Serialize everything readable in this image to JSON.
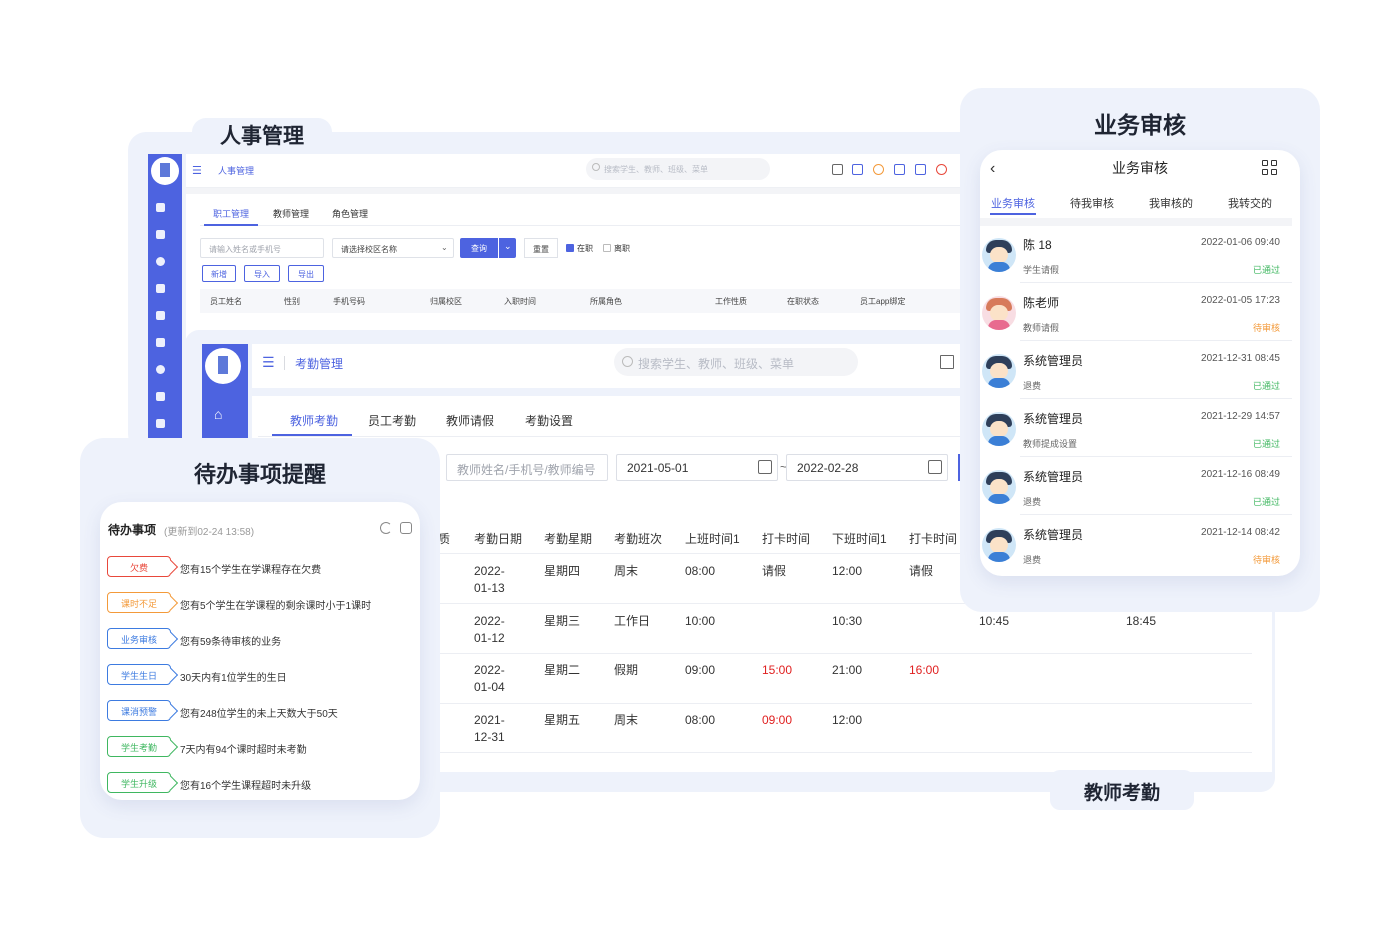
{
  "hr": {
    "section_title": "人事管理",
    "breadcrumb": "人事管理",
    "search_placeholder": "搜索学生、教师、班级、菜单",
    "tabs": [
      "职工管理",
      "教师管理",
      "角色管理"
    ],
    "name_input_placeholder": "请输入姓名或手机号",
    "campus_select": "请选择校区名称",
    "query_button": "查询",
    "reset_button": "重置",
    "checkbox_employed": "在职",
    "checkbox_left": "离职",
    "buttons": [
      "新增",
      "导入",
      "导出"
    ],
    "columns": [
      "员工姓名",
      "性别",
      "手机号码",
      "归属校区",
      "入职时间",
      "所属角色",
      "工作性质",
      "在职状态",
      "员工app绑定"
    ]
  },
  "attendance": {
    "breadcrumb": "考勤管理",
    "search_placeholder": "搜索学生、教师、班级、菜单",
    "tabs": [
      "教师考勤",
      "员工考勤",
      "教师请假",
      "考勤设置"
    ],
    "teacher_input_placeholder": "教师姓名/手机号/教师编号",
    "date_start": "2021-05-01",
    "date_separator": "~",
    "date_end": "2022-02-28",
    "columns": [
      "质",
      "考勤日期",
      "考勤星期",
      "考勤班次",
      "上班时间1",
      "打卡时间",
      "下班时间1",
      "打卡时间"
    ],
    "rows": [
      {
        "date_a": "2022-",
        "date_b": "01-13",
        "weekday": "星期四",
        "shift": "周末",
        "on1": "08:00",
        "punch1": "请假",
        "off1": "12:00",
        "punch2": "请假",
        "extra_a": "",
        "extra_b": ""
      },
      {
        "date_a": "2022-",
        "date_b": "01-12",
        "weekday": "星期三",
        "shift": "工作日",
        "on1": "10:00",
        "punch1": "",
        "off1": "10:30",
        "punch2": "",
        "extra_a": "10:45",
        "extra_b": "18:45"
      },
      {
        "date_a": "2022-",
        "date_b": "01-04",
        "weekday": "星期二",
        "shift": "假期",
        "on1": "09:00",
        "punch1": "15:00",
        "off1": "21:00",
        "punch2": "16:00",
        "extra_a": "",
        "extra_b": ""
      },
      {
        "date_a": "2021-",
        "date_b": "12-31",
        "weekday": "星期五",
        "shift": "周末",
        "on1": "08:00",
        "punch1": "09:00",
        "off1": "12:00",
        "punch2": "",
        "extra_a": "",
        "extra_b": ""
      }
    ],
    "late_color": "#e02020",
    "caption": "教师考勤"
  },
  "biz": {
    "section_title": "业务审核",
    "header_title": "业务审核",
    "tabs": [
      "业务审核",
      "待我审核",
      "我审核的",
      "我转交的"
    ],
    "items": [
      {
        "name": "陈 18",
        "date": "2022-01-06 09:40",
        "type": "学生请假",
        "status": "已通过",
        "avatar": "boy-avatar"
      },
      {
        "name": "陈老师",
        "date": "2022-01-05 17:23",
        "type": "教师请假",
        "status": "待审核",
        "avatar": "girl-avatar"
      },
      {
        "name": "系统管理员",
        "date": "2021-12-31 08:45",
        "type": "退费",
        "status": "已通过",
        "avatar": "boy-avatar"
      },
      {
        "name": "系统管理员",
        "date": "2021-12-29 14:57",
        "type": "教师提成设置",
        "status": "已通过",
        "avatar": "boy-avatar"
      },
      {
        "name": "系统管理员",
        "date": "2021-12-16 08:49",
        "type": "退费",
        "status": "已通过",
        "avatar": "boy-avatar"
      },
      {
        "name": "系统管理员",
        "date": "2021-12-14 08:42",
        "type": "退费",
        "status": "待审核",
        "avatar": "boy-avatar"
      }
    ],
    "status_colors": {
      "已通过": "#3fb760",
      "待审核": "#f39a3a"
    }
  },
  "todo": {
    "section_title": "待办事项提醒",
    "header": "待办事项",
    "updated": "(更新到02-24 13:58)",
    "items": [
      {
        "tag": "欠费",
        "text": "您有15个学生在学课程存在欠费",
        "color": "#e8483b"
      },
      {
        "tag": "课时不足",
        "text": "您有5个学生在学课程的剩余课时小于1课时",
        "color": "#f39a3a"
      },
      {
        "tag": "业务审核",
        "text": "您有59条待审核的业务",
        "color": "#3d7be0"
      },
      {
        "tag": "学生生日",
        "text": "30天内有1位学生的生日",
        "color": "#3d7be0"
      },
      {
        "tag": "课消预警",
        "text": "您有248位学生的未上天数大于50天",
        "color": "#3d7be0"
      },
      {
        "tag": "学生考勤",
        "text": "7天内有94个课时超时未考勤",
        "color": "#3fb760"
      },
      {
        "tag": "学生升级",
        "text": "您有16个学生课程超时未升级",
        "color": "#3fb760"
      }
    ]
  },
  "colors": {
    "primary": "#4d63e0",
    "panel_bg": "#eef2fb"
  }
}
